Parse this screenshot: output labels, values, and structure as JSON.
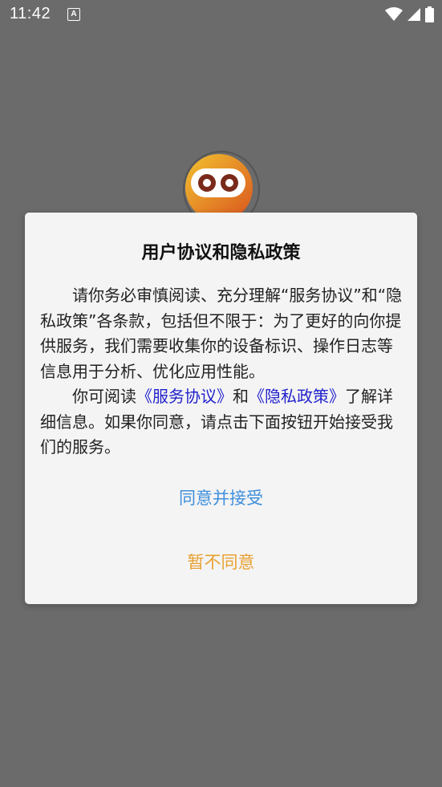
{
  "status_bar": {
    "time": "11:42",
    "notification_icon_letter": "A"
  },
  "dialog": {
    "title": "用户协议和隐私政策",
    "para1": "请你务必审慎阅读、充分理解“服务协议”和“隐私政策”各条款，包括但不限于：为了更好的向你提供服务，我们需要收集你的设备标识、操作日志等信息用于分析、优化应用性能。",
    "para2_pre": "你可阅读",
    "para2_link1": "《服务协议》",
    "para2_mid": "和",
    "para2_link2": "《隐私政策》",
    "para2_post": "了解详细信息。如果你同意，请点击下面按钮开始接受我们的服务。",
    "accept_label": "同意并接受",
    "decline_label": "暂不同意"
  },
  "colors": {
    "background": "#6b6b6b",
    "dialog_bg": "#f4f4f4",
    "link": "#2222cc",
    "accept": "#3f8fdc",
    "decline": "#e8a030"
  }
}
